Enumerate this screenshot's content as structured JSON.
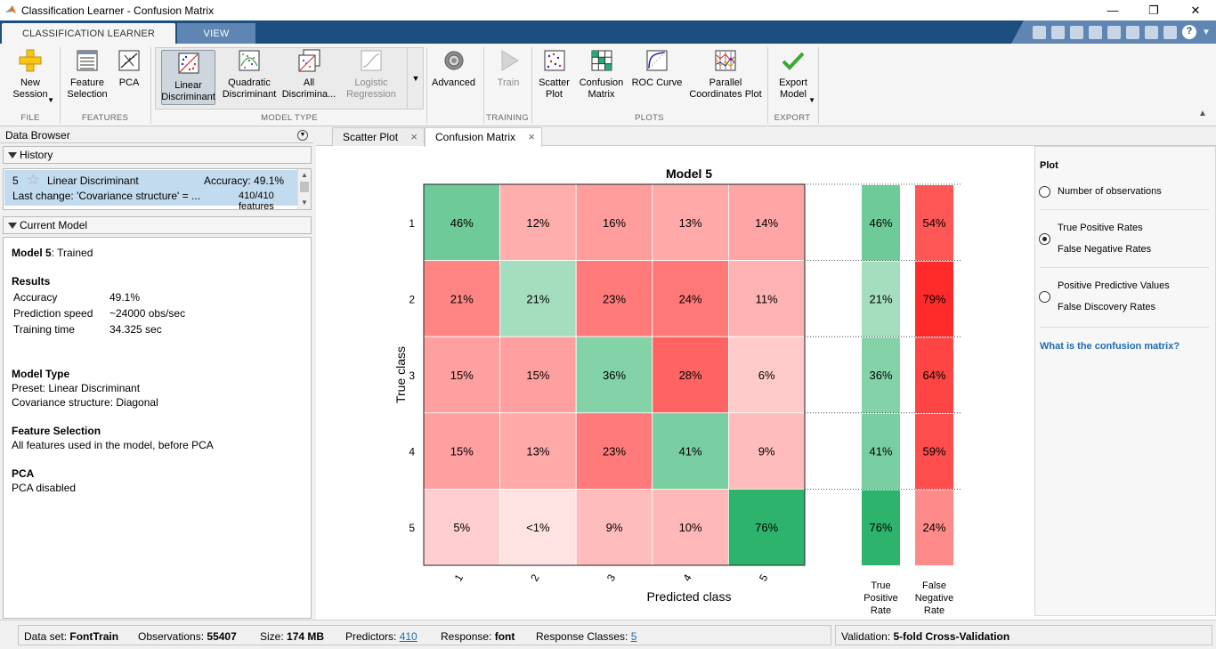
{
  "window": {
    "title": "Classification Learner - Confusion Matrix"
  },
  "ribbon_tabs": [
    "CLASSIFICATION LEARNER",
    "VIEW"
  ],
  "toolstrip": {
    "new_session": "New\nSession",
    "feature_selection": "Feature\nSelection",
    "pca": "PCA",
    "linear_discriminant": "Linear\nDiscriminant",
    "quadratic_discriminant": "Quadratic\nDiscriminant",
    "all_discriminants": "All\nDiscrimina...",
    "logistic_regression": "Logistic\nRegression",
    "advanced": "Advanced",
    "train": "Train",
    "scatter_plot": "Scatter\nPlot",
    "confusion_matrix": "Confusion\nMatrix",
    "roc_curve": "ROC Curve",
    "parallel_coordinates": "Parallel\nCoordinates Plot",
    "export_model": "Export\nModel",
    "sections": {
      "file": "FILE",
      "features": "FEATURES",
      "model_type": "MODEL TYPE",
      "training": "TRAINING",
      "plots": "PLOTS",
      "export": "EXPORT"
    }
  },
  "data_browser": {
    "title": "Data Browser",
    "history_header": "History",
    "history_item": {
      "number": "5",
      "name": "Linear Discriminant",
      "accuracy": "Accuracy:  49.1%",
      "last_change": "Last change:  'Covariance structure' = ...",
      "features": "410/410 features"
    },
    "current_model_header": "Current Model",
    "model_name": "Model 5",
    "model_status": ": Trained",
    "results_heading": "Results",
    "results": [
      {
        "label": "Accuracy",
        "value": "49.1%"
      },
      {
        "label": "Prediction speed",
        "value": "~24000 obs/sec"
      },
      {
        "label": "Training time",
        "value": "34.325 sec"
      }
    ],
    "model_type_heading": "Model Type",
    "model_type_lines": [
      "Preset: Linear Discriminant",
      "Covariance structure: Diagonal"
    ],
    "feature_selection_heading": "Feature Selection",
    "feature_selection_text": "All features used in the model, before PCA",
    "pca_heading": "PCA",
    "pca_text": "PCA disabled"
  },
  "doc_tabs": [
    "Scatter Plot",
    "Confusion Matrix"
  ],
  "chart_data": {
    "type": "heatmap",
    "title": "Model 5",
    "xlabel": "Predicted class",
    "ylabel": "True class",
    "row_labels": [
      "1",
      "2",
      "3",
      "4",
      "5"
    ],
    "col_labels": [
      "1",
      "2",
      "3",
      "4",
      "5"
    ],
    "cell_values": [
      [
        "46%",
        "12%",
        "16%",
        "13%",
        "14%"
      ],
      [
        "21%",
        "21%",
        "23%",
        "24%",
        "11%"
      ],
      [
        "15%",
        "15%",
        "36%",
        "28%",
        "6%"
      ],
      [
        "15%",
        "13%",
        "23%",
        "41%",
        "9%"
      ],
      [
        "5%",
        "<1%",
        "9%",
        "10%",
        "76%"
      ]
    ],
    "cell_numeric": [
      [
        46,
        12,
        16,
        13,
        14
      ],
      [
        21,
        21,
        23,
        24,
        11
      ],
      [
        15,
        15,
        36,
        28,
        6
      ],
      [
        15,
        13,
        23,
        41,
        9
      ],
      [
        5,
        0.5,
        9,
        10,
        76
      ]
    ],
    "true_positive_rates": [
      "46%",
      "21%",
      "36%",
      "41%",
      "76%"
    ],
    "true_positive_numeric": [
      46,
      21,
      36,
      41,
      76
    ],
    "false_negative_rates": [
      "54%",
      "79%",
      "64%",
      "59%",
      "24%"
    ],
    "false_negative_numeric": [
      54,
      79,
      64,
      59,
      24
    ],
    "tpr_label": [
      "True",
      "Positive",
      "Rate"
    ],
    "fnr_label": [
      "False",
      "Negative",
      "Rate"
    ],
    "colors": {
      "green": "#2db36b",
      "red": "#ff2a2a"
    }
  },
  "plot_options": {
    "title": "Plot",
    "options": [
      "Number of observations",
      "True Positive Rates",
      "False Negative Rates",
      "Positive Predictive Values",
      "False Discovery Rates"
    ],
    "selected": "True Positive Rates",
    "help_link": "What is the confusion matrix?"
  },
  "status_bar": {
    "data_set_label": "Data set:",
    "data_set": "FontTrain",
    "observations_label": "Observations:",
    "observations": "55407",
    "size_label": "Size:",
    "size": "174 MB",
    "predictors_label": "Predictors:",
    "predictors": "410",
    "response_label": "Response:",
    "response": "font",
    "response_classes_label": "Response Classes:",
    "response_classes": "5",
    "validation_label": "Validation:",
    "validation": "5-fold Cross-Validation"
  }
}
